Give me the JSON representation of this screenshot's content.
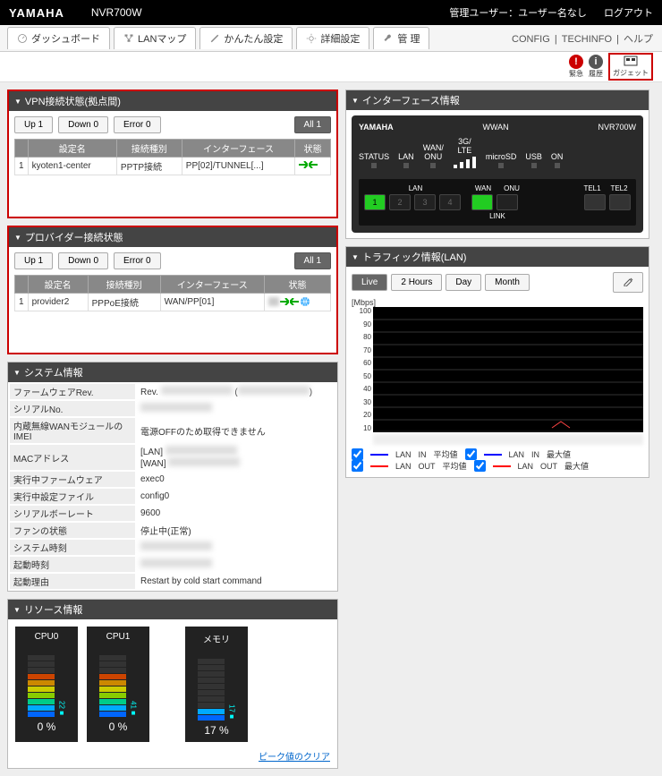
{
  "header": {
    "brand": "YAMAHA",
    "model": "NVR700W",
    "admin_label": "管理ユーザー：ユーザー名なし",
    "logout": "ログアウト"
  },
  "tabs": {
    "dashboard": "ダッシュボード",
    "lanmap": "LANマップ",
    "easy": "かんたん設定",
    "detail": "詳細設定",
    "manage": "管 理"
  },
  "links": {
    "config": "CONFIG",
    "techinfo": "TECHINFO",
    "help": "ヘルプ"
  },
  "alerts": {
    "a1": "緊急",
    "a2": "履歴",
    "gadget": "ガジェット"
  },
  "vpn": {
    "title": "VPN接続状態(拠点間)",
    "up": "Up  1",
    "down": "Down  0",
    "error": "Error  0",
    "all": "All   1",
    "cols": {
      "name": "設定名",
      "type": "接続種別",
      "iface": "インターフェース",
      "state": "状態"
    },
    "rows": [
      {
        "idx": "1",
        "name": "kyoten1-center",
        "type": "PPTP接続",
        "iface": "PP[02]/TUNNEL[...]"
      }
    ]
  },
  "provider": {
    "title": "プロバイダー接続状態",
    "up": "Up  1",
    "down": "Down  0",
    "error": "Error  0",
    "all": "All   1",
    "cols": {
      "name": "設定名",
      "type": "接続種別",
      "iface": "インターフェース",
      "state": "状態"
    },
    "rows": [
      {
        "idx": "1",
        "name": "provider2",
        "type": "PPPoE接続",
        "iface": "WAN/PP[01]"
      }
    ]
  },
  "iface": {
    "title": "インターフェース情報",
    "brand": "YAMAHA",
    "wwan": "WWAN",
    "model": "NVR700W",
    "labels": {
      "status": "STATUS",
      "lan": "LAN",
      "wanonu": "WAN/\nONU",
      "lte": "3G/\nLTE",
      "microsd": "microSD",
      "usb": "USB",
      "on": "ON"
    },
    "ports": {
      "lan": "LAN",
      "wan": "WAN",
      "onu": "ONU",
      "tel1": "TEL1",
      "tel2": "TEL2",
      "link": "LINK"
    }
  },
  "traffic": {
    "title": "トラフィック情報(LAN)",
    "btns": {
      "live": "Live",
      "h2": "2 Hours",
      "day": "Day",
      "month": "Month"
    },
    "unit": "[Mbps]",
    "legend": {
      "lan": "LAN",
      "in": "IN",
      "out": "OUT",
      "avg": "平均値",
      "max": "最大値"
    }
  },
  "sys": {
    "title": "システム情報",
    "rows": {
      "fw": "ファームウェアRev.",
      "fw_v": "Rev.",
      "serial": "シリアルNo.",
      "imei": "内蔵無線WANモジュールのIMEI",
      "imei_v": "電源OFFのため取得できません",
      "mac": "MACアドレス",
      "mac_v": "[LAN]\n[WAN]",
      "runfw": "実行中ファームウェア",
      "runfw_v": "exec0",
      "runcfg": "実行中設定ファイル",
      "runcfg_v": "config0",
      "baud": "シリアルボーレート",
      "baud_v": "9600",
      "fan": "ファンの状態",
      "fan_v": "停止中(正常)",
      "time": "システム時刻",
      "boot": "起動時刻",
      "reason": "起動理由",
      "reason_v": "Restart by cold start command"
    }
  },
  "resource": {
    "title": "リソース情報",
    "cpu0": "CPU0",
    "cpu0_v": "0",
    "cpu0_peak": "22",
    "cpu1": "CPU1",
    "cpu1_v": "0",
    "cpu1_peak": "41",
    "mem": "メモリ",
    "mem_v": "17",
    "mem_peak": "17",
    "pct": "%",
    "clear": "ピーク値のクリア"
  },
  "chart_data": {
    "type": "line",
    "title": "トラフィック情報(LAN)",
    "ylabel": "Mbps",
    "ylim": [
      0,
      100
    ],
    "yticks": [
      10,
      20,
      30,
      40,
      50,
      60,
      70,
      80,
      90,
      100
    ],
    "series": [
      {
        "name": "LAN IN 平均値",
        "values": []
      },
      {
        "name": "LAN OUT 平均値",
        "values": []
      },
      {
        "name": "LAN IN 最大値",
        "values": []
      },
      {
        "name": "LAN OUT 最大値",
        "values": []
      }
    ]
  }
}
